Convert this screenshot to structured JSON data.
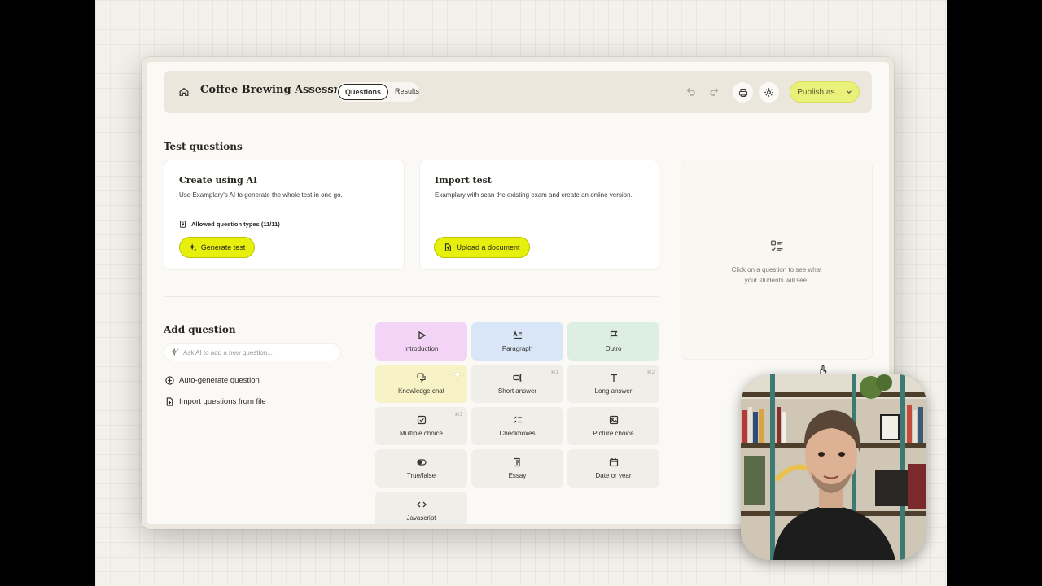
{
  "header": {
    "title": "Coffee Brewing Assessment",
    "tabs": [
      {
        "label": "Questions",
        "active": true
      },
      {
        "label": "Results",
        "active": false
      }
    ],
    "publish_label": "Publish as..."
  },
  "test_questions": {
    "heading": "Test questions",
    "create_ai": {
      "title": "Create using AI",
      "description": "Use Examplary's AI to generate the whole test in one go.",
      "allowed": "Allowed question types (11/11)",
      "button": "Generate test"
    },
    "import": {
      "title": "Import test",
      "description": "Examplary with scan the existing exam and create an online version.",
      "button": "Upload a document"
    }
  },
  "add_question": {
    "heading": "Add question",
    "ai_placeholder": "Ask AI to add a new question...",
    "actions": [
      "Auto-generate question",
      "Import questions from file"
    ]
  },
  "question_types": [
    {
      "label": "Introduction",
      "icon": "play-icon",
      "color": "#f3d4f7",
      "shortcut": ""
    },
    {
      "label": "Paragraph",
      "icon": "paragraph-icon",
      "color": "#d9e6f8",
      "shortcut": ""
    },
    {
      "label": "Outro",
      "icon": "flag-icon",
      "color": "#dcefe2",
      "shortcut": ""
    },
    {
      "label": "Knowledge chat",
      "icon": "chat-icon",
      "color": "#f7f3c6",
      "shortcut": ""
    },
    {
      "label": "Short answer",
      "icon": "short-answer-icon",
      "color": "#efeee9",
      "shortcut": "⌘1"
    },
    {
      "label": "Long answer",
      "icon": "text-icon",
      "color": "#efeee9",
      "shortcut": "⌘2"
    },
    {
      "label": "Multiple choice",
      "icon": "checkbox-icon",
      "color": "#efeee9",
      "shortcut": "⌘3"
    },
    {
      "label": "Checkboxes",
      "icon": "checklist-icon",
      "color": "#efeee9",
      "shortcut": ""
    },
    {
      "label": "Picture choice",
      "icon": "image-icon",
      "color": "#efeee9",
      "shortcut": ""
    },
    {
      "label": "True/false",
      "icon": "toggle-icon",
      "color": "#efeee9",
      "shortcut": ""
    },
    {
      "label": "Essay",
      "icon": "essay-icon",
      "color": "#efeee9",
      "shortcut": ""
    },
    {
      "label": "Date or year",
      "icon": "calendar-icon",
      "color": "#efeee9",
      "shortcut": ""
    },
    {
      "label": "Javascript",
      "icon": "code-icon",
      "color": "#efeee9",
      "shortcut": ""
    }
  ],
  "preview": {
    "message_line1": "Click on a question to see what",
    "message_line2": "your students will see."
  },
  "colors": {
    "accent": "#e6f00c",
    "publish": "#e9f178"
  }
}
